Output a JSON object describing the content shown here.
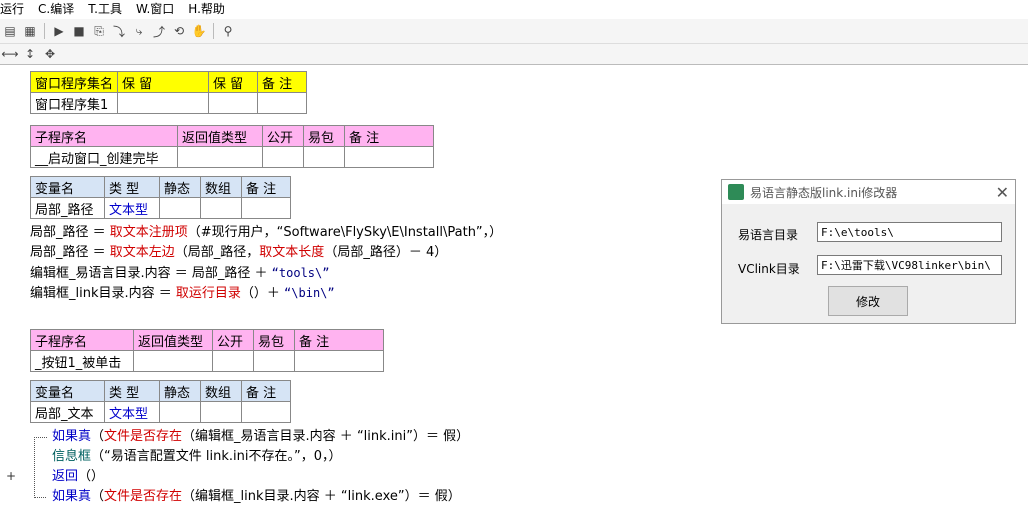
{
  "menu": [
    "运行",
    "C.编译",
    "T.工具",
    "W.窗口",
    "H.帮助"
  ],
  "table1": {
    "headers": [
      "窗口程序集名",
      "保 留",
      "保 留",
      "备 注"
    ],
    "row": [
      "窗口程序集1",
      "",
      "",
      ""
    ]
  },
  "table2": {
    "headers": [
      "子程序名",
      "返回值类型",
      "公开",
      "易包",
      "备 注"
    ],
    "row": [
      "__启动窗口_创建完毕",
      "",
      "",
      "",
      ""
    ]
  },
  "table3": {
    "headers": [
      "变量名",
      "类 型",
      "静态",
      "数组",
      "备 注"
    ],
    "row": [
      "局部_路径",
      "文本型",
      "",
      "",
      ""
    ]
  },
  "code1": [
    {
      "a": "局部_路径 ＝ ",
      "b": "取文本注册项",
      "c": "（#现行用户，“Software\\FlySky\\E\\Install\\Path”，）"
    },
    {
      "a": "局部_路径 ＝ ",
      "b": "取文本左边",
      "c": "（局部_路径，",
      "d": "取文本长度",
      "e": "（局部_路径）－ 4）"
    },
    {
      "a": "编辑框_易语言目录.内容 ＝ 局部_路径 ＋ ",
      "b": "“tools\\”"
    },
    {
      "a": "编辑框_link目录.内容 ＝ ",
      "b": "取运行目录",
      "c": "（）＋ ",
      "d": "“\\bin\\”"
    }
  ],
  "table4": {
    "headers": [
      "子程序名",
      "返回值类型",
      "公开",
      "易包",
      "备 注"
    ],
    "row": [
      "_按钮1_被单击",
      "",
      "",
      "",
      ""
    ]
  },
  "table5": {
    "headers": [
      "变量名",
      "类 型",
      "静态",
      "数组",
      "备 注"
    ],
    "row": [
      "局部_文本",
      "文本型",
      "",
      "",
      ""
    ]
  },
  "code2": [
    {
      "a": "如果真",
      "b": "（",
      "c": "文件是否存在",
      "d": "（编辑框_易语言目录.内容 ＋ “link.ini”）＝ 假）"
    },
    {
      "a": "信息框",
      "b": "（“易语言配置文件 link.ini不存在。”，0，）"
    },
    {
      "a": "返回",
      "b": "（）"
    },
    {
      "a": "如果真",
      "b": "（",
      "c": "文件是否存在",
      "d": "（编辑框_link目录.内容 ＋ “link.exe”）＝ 假）"
    }
  ],
  "dialog": {
    "title": "易语言静态版link.ini修改器",
    "label1": "易语言目录",
    "value1": "F:\\e\\tools\\",
    "label2": "VClink目录",
    "value2": "F:\\迅雷下载\\VC98linker\\bin\\",
    "button": "修改"
  }
}
